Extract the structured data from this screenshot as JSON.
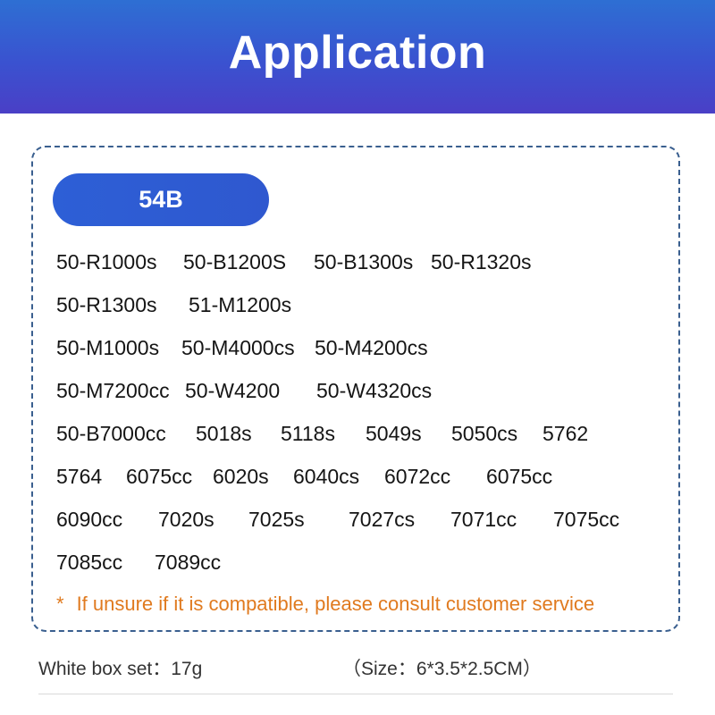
{
  "banner": {
    "title": "Application"
  },
  "card": {
    "label": "54B",
    "models": [
      "50-R1000s",
      "50-B1200S",
      "50-B1300s",
      "50-R1320s",
      "50-R1300s",
      "51-M1200s",
      "50-M1000s",
      "50-M4000cs",
      "50-M4200cs",
      "50-M7200cc",
      "50-W4200",
      "50-W4320cs",
      "50-B7000cc",
      "5018s",
      "5118s",
      "5049s",
      "5050cs",
      "5762",
      "5764",
      "6075cc",
      "6020s",
      "6040cs",
      "6072cc",
      "6075cc",
      "6090cc",
      "7020s",
      "7025s",
      "7027cs",
      "7071cc",
      "7075cc",
      "7085cc",
      "7089cc"
    ],
    "note_star": "*",
    "note": "If unsure if it is compatible,  please consult customer service"
  },
  "footer": {
    "weight": "White box set：17g",
    "size": "（Size：6*3.5*2.5CM）"
  },
  "colors": {
    "banner_top": "#2e6fd3",
    "banner_bottom": "#4a3fc6",
    "pill": "#2d5fd6",
    "note": "#e07a1f",
    "card_border": "#3a5f8f"
  }
}
